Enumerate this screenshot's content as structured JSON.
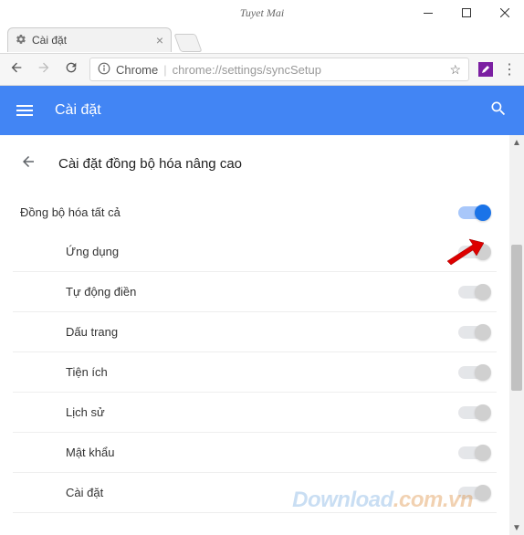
{
  "window": {
    "title": "Tuyet Mai"
  },
  "tab": {
    "title": "Cài đặt"
  },
  "omnibox": {
    "scheme_label": "Chrome",
    "url": "chrome://settings/syncSetup"
  },
  "header": {
    "title": "Cài đặt"
  },
  "page": {
    "title": "Cài đặt đồng bộ hóa nâng cao"
  },
  "sync_all": {
    "label": "Đồng bộ hóa tất cả",
    "enabled": true
  },
  "items": [
    {
      "label": "Ứng dụng",
      "enabled": false
    },
    {
      "label": "Tự động điền",
      "enabled": false
    },
    {
      "label": "Dấu trang",
      "enabled": false
    },
    {
      "label": "Tiện ích",
      "enabled": false
    },
    {
      "label": "Lịch sử",
      "enabled": false
    },
    {
      "label": "Mật khẩu",
      "enabled": false
    },
    {
      "label": "Cài đặt",
      "enabled": false
    }
  ],
  "watermark": {
    "main": "Download",
    "suffix": ".com.vn"
  }
}
